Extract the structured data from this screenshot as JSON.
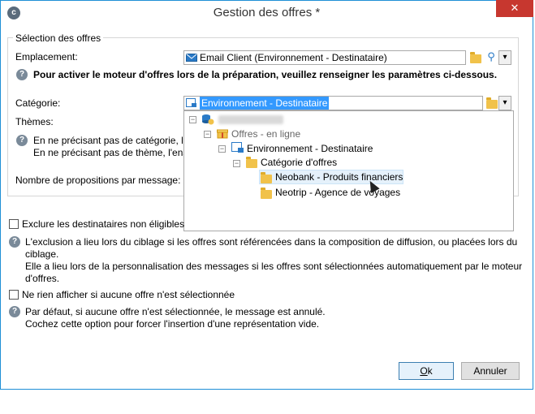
{
  "window": {
    "title": "Gestion des offres *",
    "close_glyph": "✕",
    "app_icon_glyph": "c"
  },
  "group": {
    "legend": "Sélection des offres",
    "emplacement_label": "Emplacement:",
    "emplacement_value": "Email Client (Environnement - Destinataire)",
    "info_prep": "Pour activer le moteur d'offres lors de la préparation, veuillez renseigner les paramètres ci-dessous.",
    "categorie_label": "Catégorie:",
    "categorie_value": "Environnement - Destinataire",
    "themes_label": "Thèmes:",
    "info_cat_line1": "En ne précisant pas de catégorie, l'e",
    "info_cat_line2": "En ne précisant pas de thème, l'ens",
    "nb_propositions_label": "Nombre de propositions par message:"
  },
  "tree": {
    "items": [
      {
        "label": ""
      },
      {
        "label": "Offres - en ligne"
      },
      {
        "label": "Environnement - Destinataire"
      },
      {
        "label": "Catégorie d'offres"
      },
      {
        "label": "Neobank - Produits financiers"
      },
      {
        "label": "Neotrip - Agence de voyages"
      }
    ]
  },
  "options": {
    "exclude_label": "Exclure les destinataires non éligibles",
    "exclude_help_line1": "L'exclusion a lieu lors du ciblage si les offres sont référencées dans la composition de diffusion, ou placées lors du",
    "exclude_help_line2": "ciblage.",
    "exclude_help_line3": "Elle a lieu lors de la personnalisation des messages si les offres sont sélectionnées automatiquement par le moteur",
    "exclude_help_line4": "d'offres.",
    "noshow_label": "Ne rien afficher si aucune offre n'est sélectionnée",
    "noshow_help_line1": "Par défaut, si aucune offre n'est sélectionnée, le message est annulé.",
    "noshow_help_line2": "Cochez cette option pour forcer l'insertion d'une représentation vide."
  },
  "buttons": {
    "ok_mnemonic": "O",
    "ok_rest": "k",
    "cancel": "Annuler"
  },
  "icons": {
    "help": "?",
    "dropdown": "▾",
    "search": "⚲",
    "minus": "−"
  },
  "colors": {
    "accent": "#1f8fd6",
    "selection": "#3399ff",
    "close": "#c7372f",
    "folder": "#f1c24a"
  }
}
